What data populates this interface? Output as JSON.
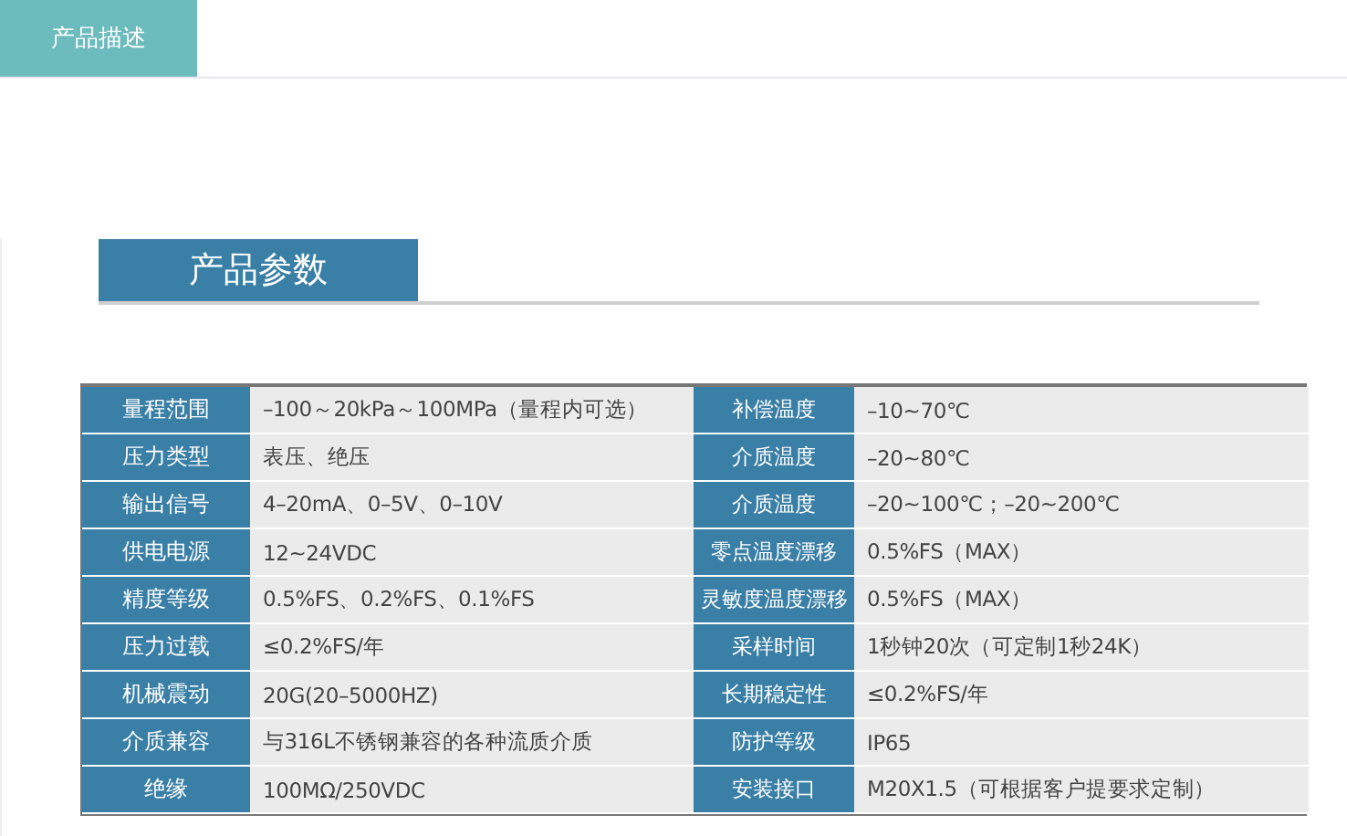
{
  "tabs": [
    {
      "label": "产品描述",
      "selected": true
    }
  ],
  "section_title": "产品参数",
  "rows": [
    {
      "left": {
        "label": "量程范围",
        "value": "–100～20kPa～100MPa（量程内可选）"
      },
      "right": {
        "label": "补偿温度",
        "value": "–10~70℃"
      }
    },
    {
      "left": {
        "label": "压力类型",
        "value": "表压、绝压"
      },
      "right": {
        "label": "介质温度",
        "value": "–20~80℃"
      }
    },
    {
      "left": {
        "label": "输出信号",
        "value": "4–20mA、0–5V、0–10V"
      },
      "right": {
        "label": "介质温度",
        "value": "–20~100℃；–20~200℃"
      }
    },
    {
      "left": {
        "label": "供电电源",
        "value": "12~24VDC"
      },
      "right": {
        "label": "零点温度漂移",
        "value": "0.5%FS（MAX）"
      }
    },
    {
      "left": {
        "label": "精度等级",
        "value": "0.5%FS、0.2%FS、0.1%FS"
      },
      "right": {
        "label": "灵敏度温度漂移",
        "value": "0.5%FS（MAX）"
      }
    },
    {
      "left": {
        "label": "压力过载",
        "value": "≤0.2%FS/年"
      },
      "right": {
        "label": "采样时间",
        "value": "1秒钟20次（可定制1秒24K）"
      }
    },
    {
      "left": {
        "label": "机械震动",
        "value": "20G(20–5000HZ)"
      },
      "right": {
        "label": "长期稳定性",
        "value": "≤0.2%FS/年"
      }
    },
    {
      "left": {
        "label": "介质兼容",
        "value": "与316L不锈钢兼容的各种流质介质"
      },
      "right": {
        "label": "防护等级",
        "value": "IP65"
      }
    },
    {
      "left": {
        "label": "绝缘",
        "value": "100MΩ/250VDC"
      },
      "right": {
        "label": "安装接口",
        "value": "M20X1.5（可根据客户提要求定制）"
      }
    }
  ]
}
